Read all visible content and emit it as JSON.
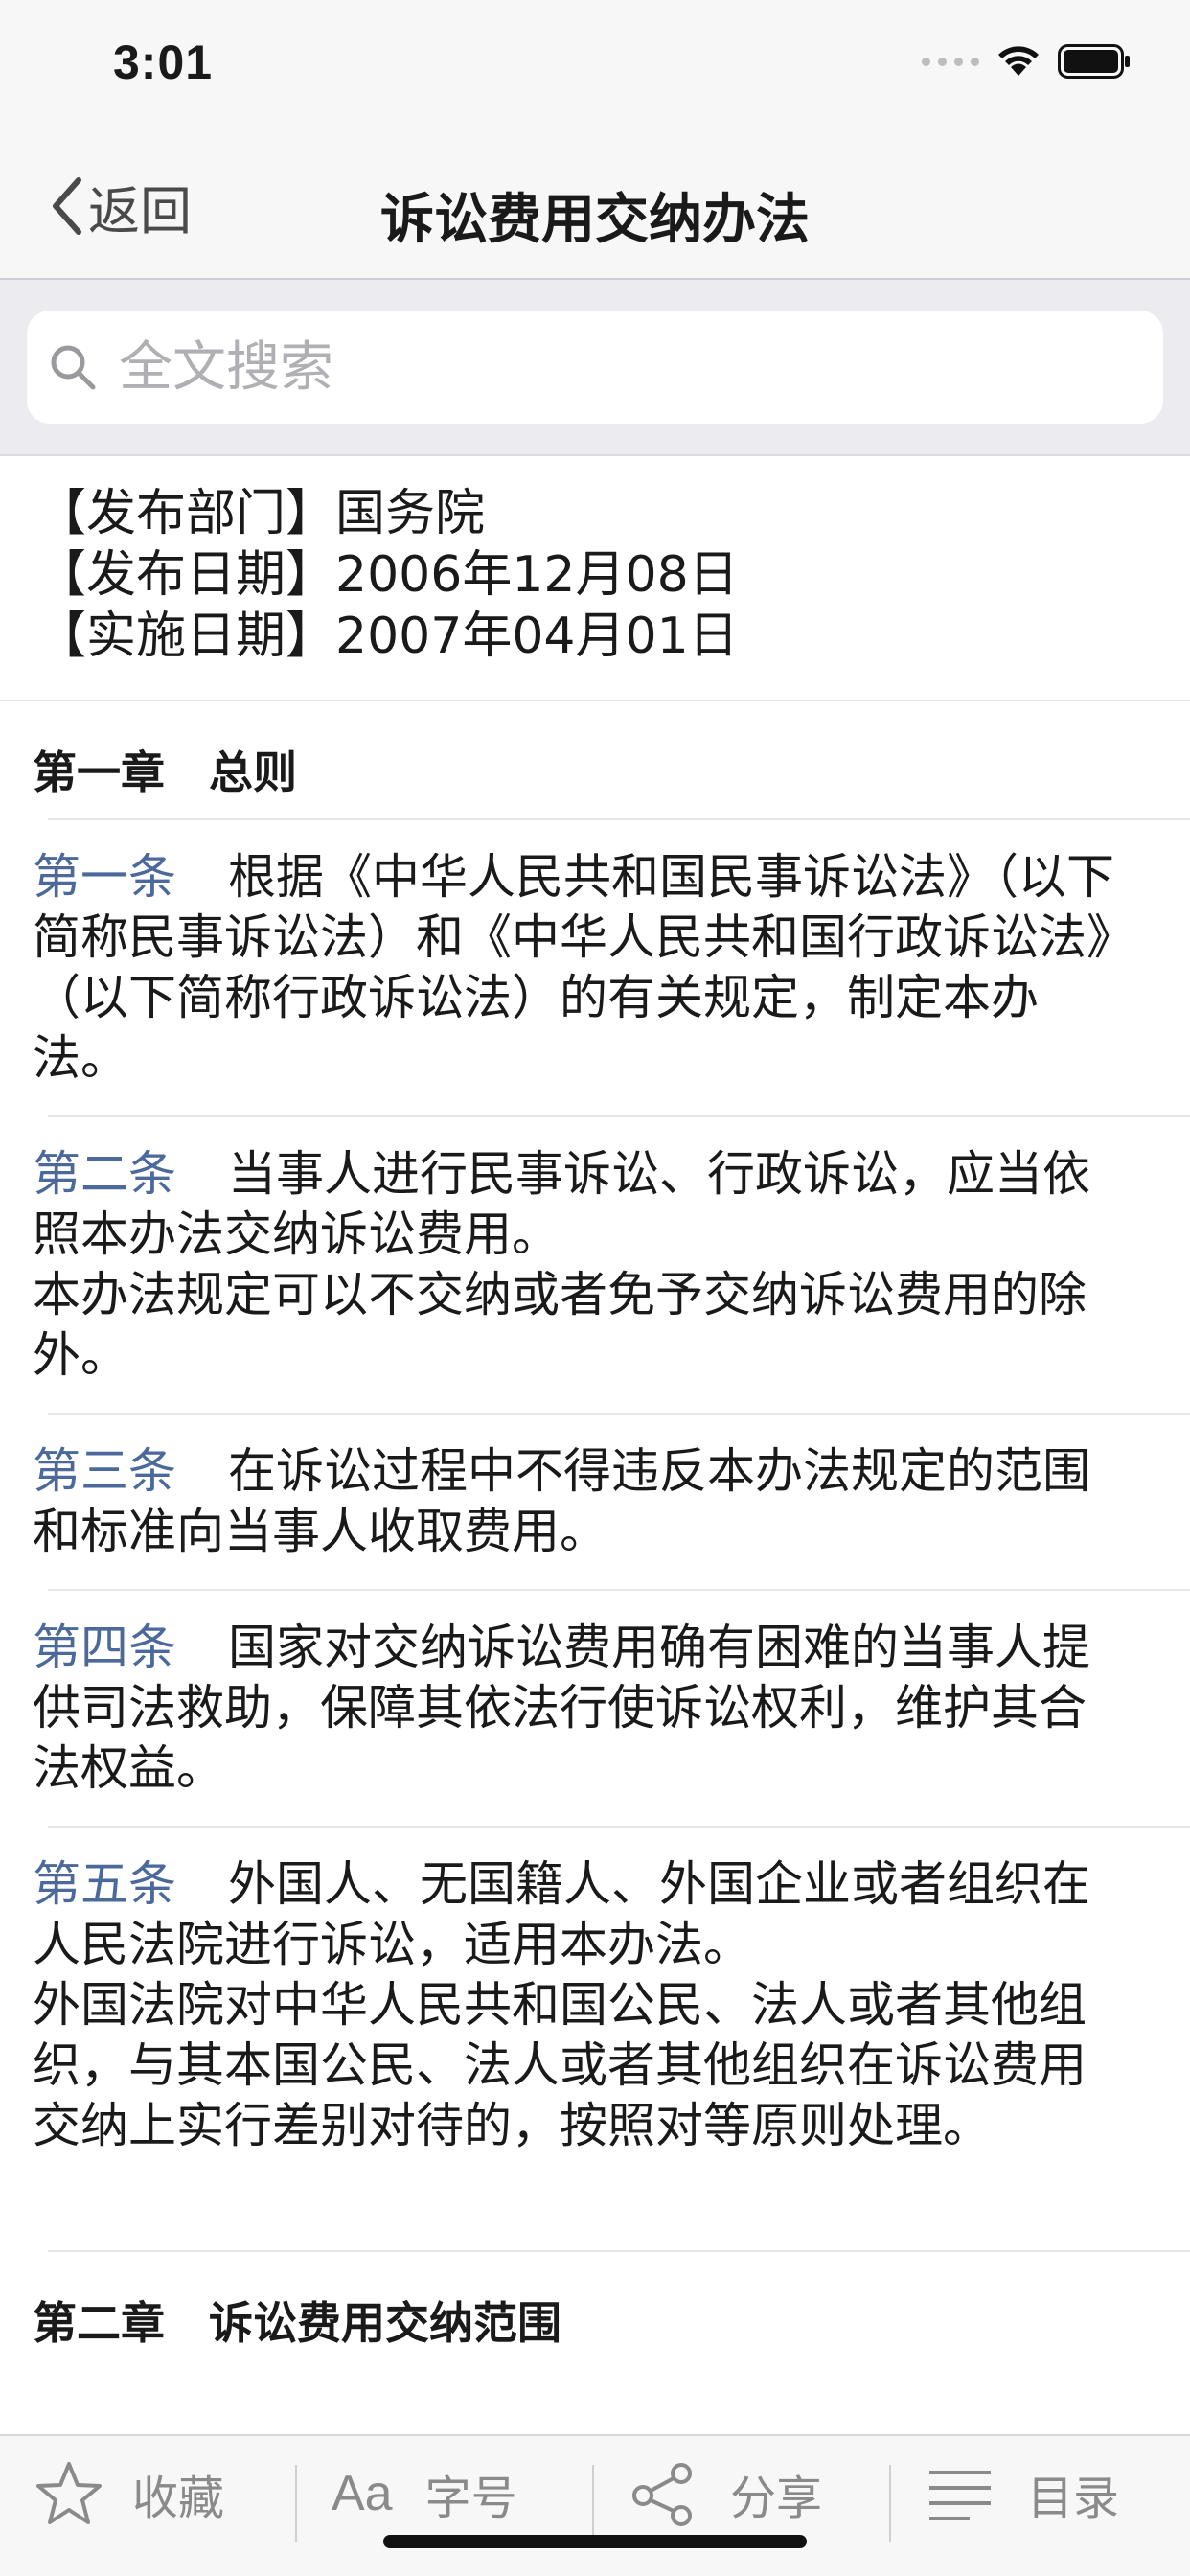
{
  "status_bar": {
    "time": "3:01"
  },
  "nav": {
    "back_label": "返回",
    "title": "诉讼费用交纳办法"
  },
  "search": {
    "placeholder": "全文搜索",
    "value": ""
  },
  "meta": [
    {
      "text": "【发布部门】国务院"
    },
    {
      "text": "【发布日期】2006年12月08日"
    },
    {
      "text": "【实施日期】2007年04月01日"
    }
  ],
  "chapters": [
    {
      "title": "第一章　总则"
    },
    {
      "title": "第二章　诉讼费用交纳范围"
    }
  ],
  "articles": [
    {
      "label": "第一条",
      "paragraphs": [
        "根据《中华人民共和国民事诉讼法》（以下简称民事诉讼法）和《中华人民共和国行政诉讼法》（以下简称行政诉讼法）的有关规定，制定本办法。"
      ]
    },
    {
      "label": "第二条",
      "paragraphs": [
        "当事人进行民事诉讼、行政诉讼，应当依照本办法交纳诉讼费用。",
        "本办法规定可以不交纳或者免予交纳诉讼费用的除外。"
      ]
    },
    {
      "label": "第三条",
      "paragraphs": [
        "在诉讼过程中不得违反本办法规定的范围和标准向当事人收取费用。"
      ]
    },
    {
      "label": "第四条",
      "paragraphs": [
        "国家对交纳诉讼费用确有困难的当事人提供司法救助，保障其依法行使诉讼权利，维护其合法权益。"
      ]
    },
    {
      "label": "第五条",
      "paragraphs": [
        "外国人、无国籍人、外国企业或者组织在人民法院进行诉讼，适用本办法。",
        "外国法院对中华人民共和国公民、法人或者其他组织，与其本国公民、法人或者其他组织在诉讼费用交纳上实行差别对待的，按照对等原则处理。"
      ]
    }
  ],
  "toolbar": {
    "favorite_label": "收藏",
    "font_glyph": "Aa",
    "font_label": "字号",
    "share_label": "分享",
    "toc_label": "目录"
  },
  "colors": {
    "article_label": "#4b6a9b",
    "toolbar_icon": "#8a8a8a"
  }
}
